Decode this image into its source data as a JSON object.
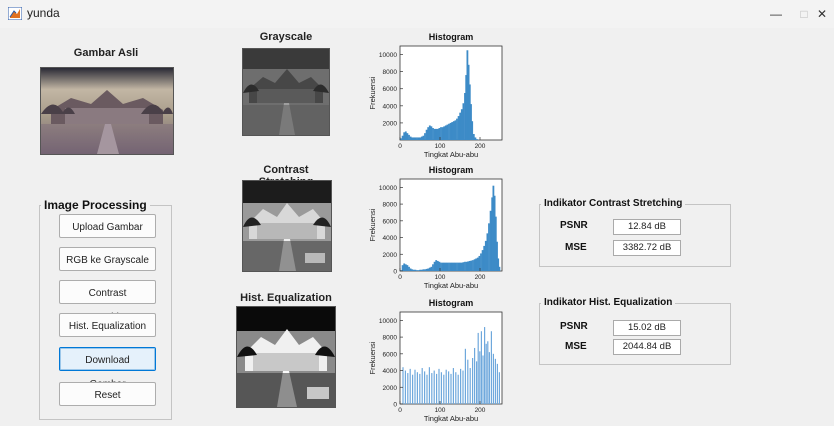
{
  "window": {
    "title": "yunda",
    "minimize": "—",
    "maximize": "□",
    "close": "✕"
  },
  "labels": {
    "original": "Gambar Asli",
    "grayscale": "Grayscale",
    "contrast": "Contrast Stretching",
    "histeq": "Hist. Equalization"
  },
  "processing": {
    "title": "Image Processing",
    "buttons": [
      "Upload Gambar",
      "RGB ke Grayscale",
      "Contrast Stretching",
      "Hist. Equalization",
      "Download Gambar",
      "Reset"
    ]
  },
  "indicators": {
    "contrast": {
      "title": "Indikator Contrast Stretching",
      "psnr_label": "PSNR",
      "psnr": "12.84 dB",
      "mse_label": "MSE",
      "mse": "3382.72 dB"
    },
    "histeq": {
      "title": "Indikator Hist. Equalization",
      "psnr_label": "PSNR",
      "psnr": "15.02 dB",
      "mse_label": "MSE",
      "mse": "2044.84 dB"
    }
  },
  "chart_data": [
    {
      "type": "bar",
      "title": "Histogram",
      "xlabel": "Tingkat Abu-abu",
      "ylabel": "Frekuensi",
      "xlim": [
        0,
        255
      ],
      "ylim": [
        0,
        11000
      ],
      "xticks": [
        "0",
        "100",
        "200"
      ],
      "yticks": [
        "2000",
        "4000",
        "6000",
        "8000",
        "10000"
      ],
      "bins": [
        [
          0,
          200
        ],
        [
          4,
          500
        ],
        [
          8,
          900
        ],
        [
          12,
          1000
        ],
        [
          16,
          800
        ],
        [
          20,
          600
        ],
        [
          24,
          400
        ],
        [
          28,
          300
        ],
        [
          32,
          300
        ],
        [
          36,
          300
        ],
        [
          40,
          300
        ],
        [
          44,
          300
        ],
        [
          48,
          300
        ],
        [
          52,
          400
        ],
        [
          56,
          500
        ],
        [
          60,
          800
        ],
        [
          64,
          1200
        ],
        [
          68,
          1500
        ],
        [
          72,
          1700
        ],
        [
          76,
          1600
        ],
        [
          80,
          1400
        ],
        [
          84,
          1300
        ],
        [
          88,
          1300
        ],
        [
          92,
          1300
        ],
        [
          96,
          1400
        ],
        [
          100,
          1500
        ],
        [
          104,
          1500
        ],
        [
          108,
          1600
        ],
        [
          112,
          1700
        ],
        [
          116,
          1800
        ],
        [
          120,
          1900
        ],
        [
          124,
          2000
        ],
        [
          128,
          2100
        ],
        [
          132,
          2200
        ],
        [
          136,
          2300
        ],
        [
          140,
          2500
        ],
        [
          144,
          2800
        ],
        [
          148,
          3200
        ],
        [
          152,
          3600
        ],
        [
          156,
          4300
        ],
        [
          160,
          5500
        ],
        [
          163,
          7600
        ],
        [
          166,
          10500
        ],
        [
          169,
          8800
        ],
        [
          172,
          6500
        ],
        [
          175,
          4200
        ],
        [
          178,
          2200
        ],
        [
          182,
          700
        ],
        [
          186,
          300
        ],
        [
          190,
          100
        ],
        [
          196,
          50
        ],
        [
          204,
          0
        ]
      ]
    },
    {
      "type": "bar",
      "title": "Histogram",
      "xlabel": "Tingkat Abu-abu",
      "ylabel": "Frekuensi",
      "xlim": [
        0,
        255
      ],
      "ylim": [
        0,
        11000
      ],
      "xticks": [
        "0",
        "100",
        "200"
      ],
      "yticks": [
        "0",
        "2000",
        "4000",
        "6000",
        "8000",
        "10000"
      ],
      "bins": [
        [
          0,
          100
        ],
        [
          4,
          700
        ],
        [
          8,
          900
        ],
        [
          12,
          800
        ],
        [
          16,
          700
        ],
        [
          20,
          500
        ],
        [
          24,
          300
        ],
        [
          28,
          200
        ],
        [
          32,
          150
        ],
        [
          36,
          150
        ],
        [
          40,
          100
        ],
        [
          44,
          100
        ],
        [
          48,
          150
        ],
        [
          52,
          150
        ],
        [
          56,
          200
        ],
        [
          60,
          200
        ],
        [
          64,
          250
        ],
        [
          68,
          300
        ],
        [
          72,
          400
        ],
        [
          76,
          500
        ],
        [
          80,
          800
        ],
        [
          84,
          1100
        ],
        [
          88,
          1300
        ],
        [
          92,
          1200
        ],
        [
          96,
          1100
        ],
        [
          100,
          1000
        ],
        [
          104,
          1000
        ],
        [
          108,
          1000
        ],
        [
          112,
          1000
        ],
        [
          116,
          1000
        ],
        [
          120,
          1000
        ],
        [
          124,
          1000
        ],
        [
          128,
          1000
        ],
        [
          132,
          1000
        ],
        [
          136,
          1000
        ],
        [
          140,
          1000
        ],
        [
          144,
          1000
        ],
        [
          148,
          1000
        ],
        [
          152,
          1000
        ],
        [
          156,
          1050
        ],
        [
          160,
          1100
        ],
        [
          164,
          1100
        ],
        [
          168,
          1150
        ],
        [
          172,
          1200
        ],
        [
          176,
          1250
        ],
        [
          180,
          1300
        ],
        [
          184,
          1400
        ],
        [
          188,
          1500
        ],
        [
          192,
          1600
        ],
        [
          196,
          1800
        ],
        [
          200,
          2100
        ],
        [
          204,
          2500
        ],
        [
          208,
          3000
        ],
        [
          212,
          3600
        ],
        [
          216,
          4500
        ],
        [
          220,
          5700
        ],
        [
          224,
          7200
        ],
        [
          228,
          8800
        ],
        [
          231,
          10200
        ],
        [
          234,
          9000
        ],
        [
          237,
          6500
        ],
        [
          240,
          3500
        ],
        [
          243,
          1500
        ],
        [
          246,
          500
        ]
      ]
    },
    {
      "type": "bar",
      "title": "Histogram",
      "xlabel": "Tingkat Abu-abu",
      "ylabel": "Frekuensi",
      "xlim": [
        0,
        255
      ],
      "ylim": [
        0,
        11000
      ],
      "xticks": [
        "0",
        "100",
        "200"
      ],
      "yticks": [
        "0",
        "2000",
        "4000",
        "6000",
        "8000",
        "10000"
      ],
      "bins": [
        [
          5,
          4400
        ],
        [
          11,
          4000
        ],
        [
          17,
          3700
        ],
        [
          23,
          4200
        ],
        [
          29,
          3500
        ],
        [
          35,
          4100
        ],
        [
          41,
          3800
        ],
        [
          47,
          3600
        ],
        [
          53,
          4300
        ],
        [
          59,
          3900
        ],
        [
          65,
          3500
        ],
        [
          71,
          4400
        ],
        [
          77,
          3700
        ],
        [
          83,
          4000
        ],
        [
          89,
          3600
        ],
        [
          95,
          4200
        ],
        [
          101,
          3800
        ],
        [
          107,
          3500
        ],
        [
          113,
          4100
        ],
        [
          119,
          3900
        ],
        [
          125,
          3600
        ],
        [
          131,
          4300
        ],
        [
          137,
          3800
        ],
        [
          143,
          3500
        ],
        [
          149,
          4200
        ],
        [
          155,
          4000
        ],
        [
          161,
          6600
        ],
        [
          167,
          5300
        ],
        [
          173,
          4300
        ],
        [
          179,
          5500
        ],
        [
          184,
          6700
        ],
        [
          189,
          5100
        ],
        [
          193,
          8500
        ],
        [
          197,
          6300
        ],
        [
          201,
          8700
        ],
        [
          205,
          5800
        ],
        [
          209,
          9200
        ],
        [
          213,
          7200
        ],
        [
          217,
          7500
        ],
        [
          221,
          6200
        ],
        [
          226,
          8700
        ],
        [
          231,
          6000
        ],
        [
          236,
          5400
        ],
        [
          241,
          4800
        ],
        [
          246,
          3800
        ]
      ]
    }
  ]
}
